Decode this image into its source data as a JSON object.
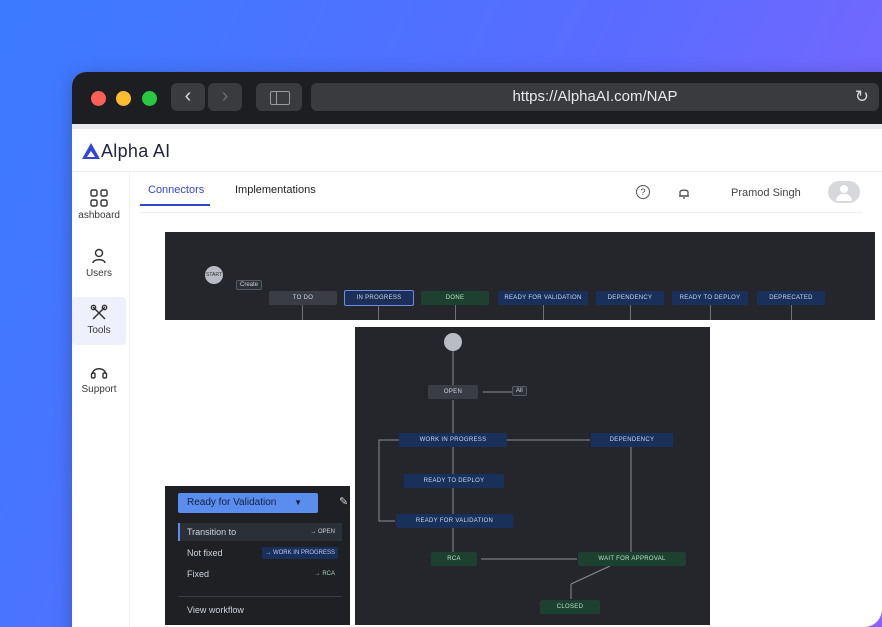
{
  "browser": {
    "url": "https://AlphaAI.com/NAP"
  },
  "app": {
    "brand": "Alpha AI",
    "user_name": "Pramod Singh"
  },
  "sidebar": {
    "items": [
      {
        "label": "ashboard",
        "icon": "grid-icon"
      },
      {
        "label": "Users",
        "icon": "user-icon"
      },
      {
        "label": "Tools",
        "icon": "tools-icon"
      },
      {
        "label": "Support",
        "icon": "headset-icon"
      }
    ]
  },
  "tabs": [
    {
      "label": "Connectors",
      "active": true
    },
    {
      "label": "Implementations",
      "active": false
    }
  ],
  "workflow_bar": {
    "start": "START",
    "create_label": "Create",
    "statuses": [
      "TO DO",
      "IN PROGRESS",
      "DONE",
      "READY FOR VALIDATION",
      "DEPENDENCY",
      "READY TO DEPLOY",
      "DEPRECATED"
    ]
  },
  "workflow_diagram": {
    "nodes": {
      "open": "OPEN",
      "all": "All",
      "work_in_progress": "WORK IN PROGRESS",
      "dependency": "DEPENDENCY",
      "ready_to_deploy": "READY TO DEPLOY",
      "ready_for_validation": "READY FOR VALIDATION",
      "rca": "RCA",
      "wait_for_approval": "WAIT FOR APPROVAL",
      "closed": "CLOSED"
    }
  },
  "status_menu": {
    "current": "Ready for Validation",
    "transitions": [
      {
        "label": "Transition to",
        "target": "→ OPEN"
      },
      {
        "label": "Not fixed",
        "target": "→ WORK IN PROGRESS"
      },
      {
        "label": "Fixed",
        "target": "→ RCA"
      }
    ],
    "view_workflow": "View workflow"
  },
  "colors": {
    "accent": "#3346d3",
    "status_blue": "#19305a",
    "status_green": "#1d4030",
    "dropdown_blue": "#5b8def"
  }
}
